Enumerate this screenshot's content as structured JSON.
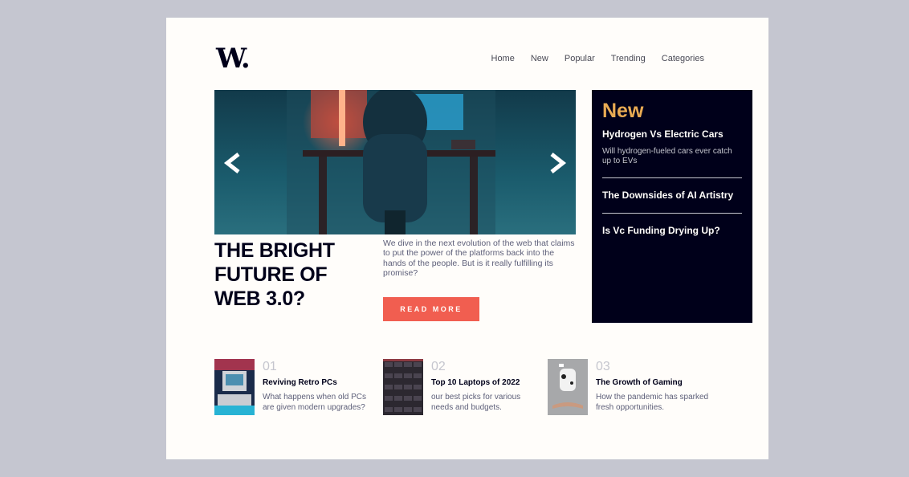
{
  "logo": {
    "text": "W."
  },
  "nav": [
    "Home",
    "New",
    "Popular",
    "Trending",
    "Categories"
  ],
  "hero": {
    "image_alt": "person at desk with glowing computer",
    "prev_icon": "chevron-left-icon",
    "next_icon": "chevron-right-icon",
    "headline": "THE BRIGHT FUTURE OF WEB 3.0?",
    "lede": "We dive in the next evolution of the web that claims to put the power of the platforms back into the hands of the people. But is it really fulfilling its promise?",
    "cta": "READ MORE"
  },
  "new_panel": {
    "title": "New",
    "items": [
      {
        "title": "Hydrogen Vs Electric Cars",
        "desc": "Will hydrogen-fueled cars ever catch up to EVs"
      },
      {
        "title": "The Downsides of AI Artistry"
      },
      {
        "title": "Is Vc Funding Drying Up?"
      }
    ]
  },
  "bottom": [
    {
      "num": "01",
      "title": "Reviving Retro PCs",
      "desc": "What happens when old PCs are given modern upgrades?"
    },
    {
      "num": "02",
      "title": "Top 10 Laptops of 2022",
      "desc": "our best picks for various needs and budgets."
    },
    {
      "num": "03",
      "title": "The Growth of Gaming",
      "desc": "How the pandemic has sparked fresh opportunities."
    }
  ],
  "colors": {
    "accent_orange": "#e9ab53",
    "accent_red": "#f15e50",
    "dark": "#00001a",
    "page_bg": "#fffdfa",
    "outer_bg": "#c5c6d0"
  }
}
